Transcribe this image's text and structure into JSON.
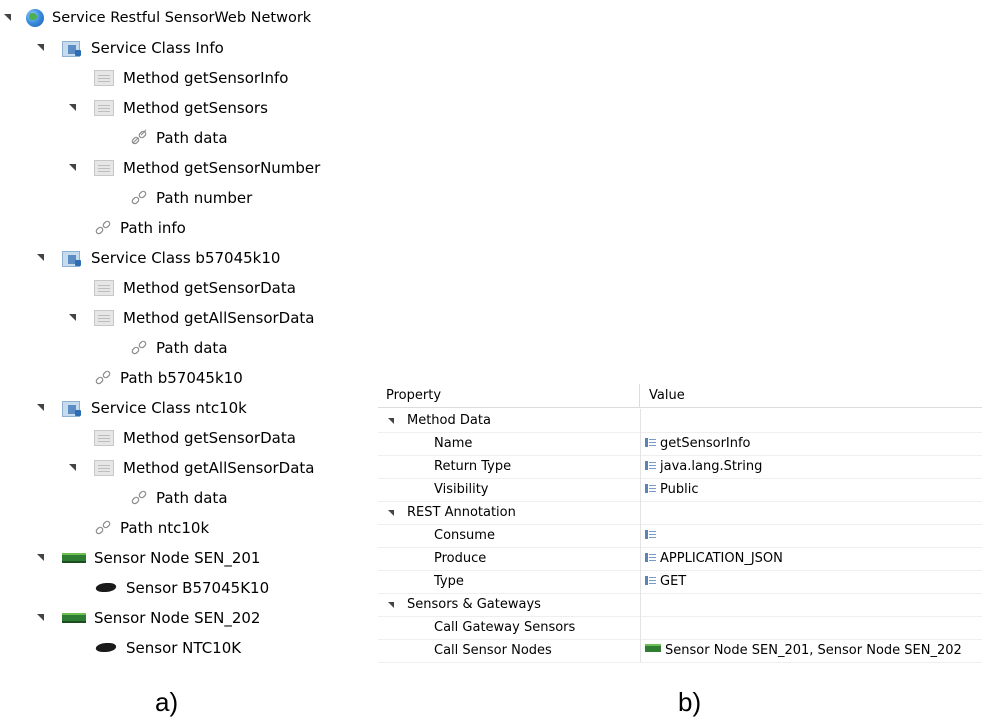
{
  "tree": {
    "rows": [
      {
        "label": "Service Restful SensorWeb Network",
        "icon": "globe-icon"
      },
      {
        "label": "Service Class Info",
        "icon": "service-class-icon"
      },
      {
        "label": "Method getSensorInfo",
        "icon": "method-icon"
      },
      {
        "label": "Method getSensors",
        "icon": "method-icon"
      },
      {
        "label": "Path data",
        "icon": "link-icon"
      },
      {
        "label": "Method getSensorNumber",
        "icon": "method-icon"
      },
      {
        "label": "Path number",
        "icon": "link-icon"
      },
      {
        "label": "Path info",
        "icon": "link-icon"
      },
      {
        "label": "Service Class b57045k10",
        "icon": "service-class-icon"
      },
      {
        "label": "Method getSensorData",
        "icon": "method-icon"
      },
      {
        "label": "Method getAllSensorData",
        "icon": "method-icon"
      },
      {
        "label": "Path data",
        "icon": "link-icon"
      },
      {
        "label": "Path b57045k10",
        "icon": "link-icon"
      },
      {
        "label": "Service Class ntc10k",
        "icon": "service-class-icon"
      },
      {
        "label": "Method getSensorData",
        "icon": "method-icon"
      },
      {
        "label": "Method getAllSensorData",
        "icon": "method-icon"
      },
      {
        "label": "Path data",
        "icon": "link-icon"
      },
      {
        "label": "Path ntc10k",
        "icon": "link-icon"
      },
      {
        "label": "Sensor Node SEN_201",
        "icon": "sensor-node-icon"
      },
      {
        "label": "Sensor B57045K10",
        "icon": "sensor-chip-icon"
      },
      {
        "label": "Sensor Node SEN_202",
        "icon": "sensor-node-icon"
      },
      {
        "label": "Sensor NTC10K",
        "icon": "sensor-chip-icon"
      }
    ]
  },
  "properties": {
    "header": {
      "property": "Property",
      "value": "Value"
    },
    "rows": [
      {
        "name": "Method Data",
        "value": ""
      },
      {
        "name": "Name",
        "value": "getSensorInfo"
      },
      {
        "name": "Return Type",
        "value": "java.lang.String"
      },
      {
        "name": "Visibility",
        "value": "Public"
      },
      {
        "name": "REST Annotation",
        "value": ""
      },
      {
        "name": "Consume",
        "value": ""
      },
      {
        "name": "Produce",
        "value": "APPLICATION_JSON"
      },
      {
        "name": "Type",
        "value": "GET"
      },
      {
        "name": "Sensors & Gateways",
        "value": ""
      },
      {
        "name": "Call Gateway Sensors",
        "value": ""
      },
      {
        "name": "Call Sensor Nodes",
        "value": "Sensor Node SEN_201, Sensor Node SEN_202"
      }
    ]
  },
  "captions": {
    "a": "a)",
    "b": "b)"
  }
}
